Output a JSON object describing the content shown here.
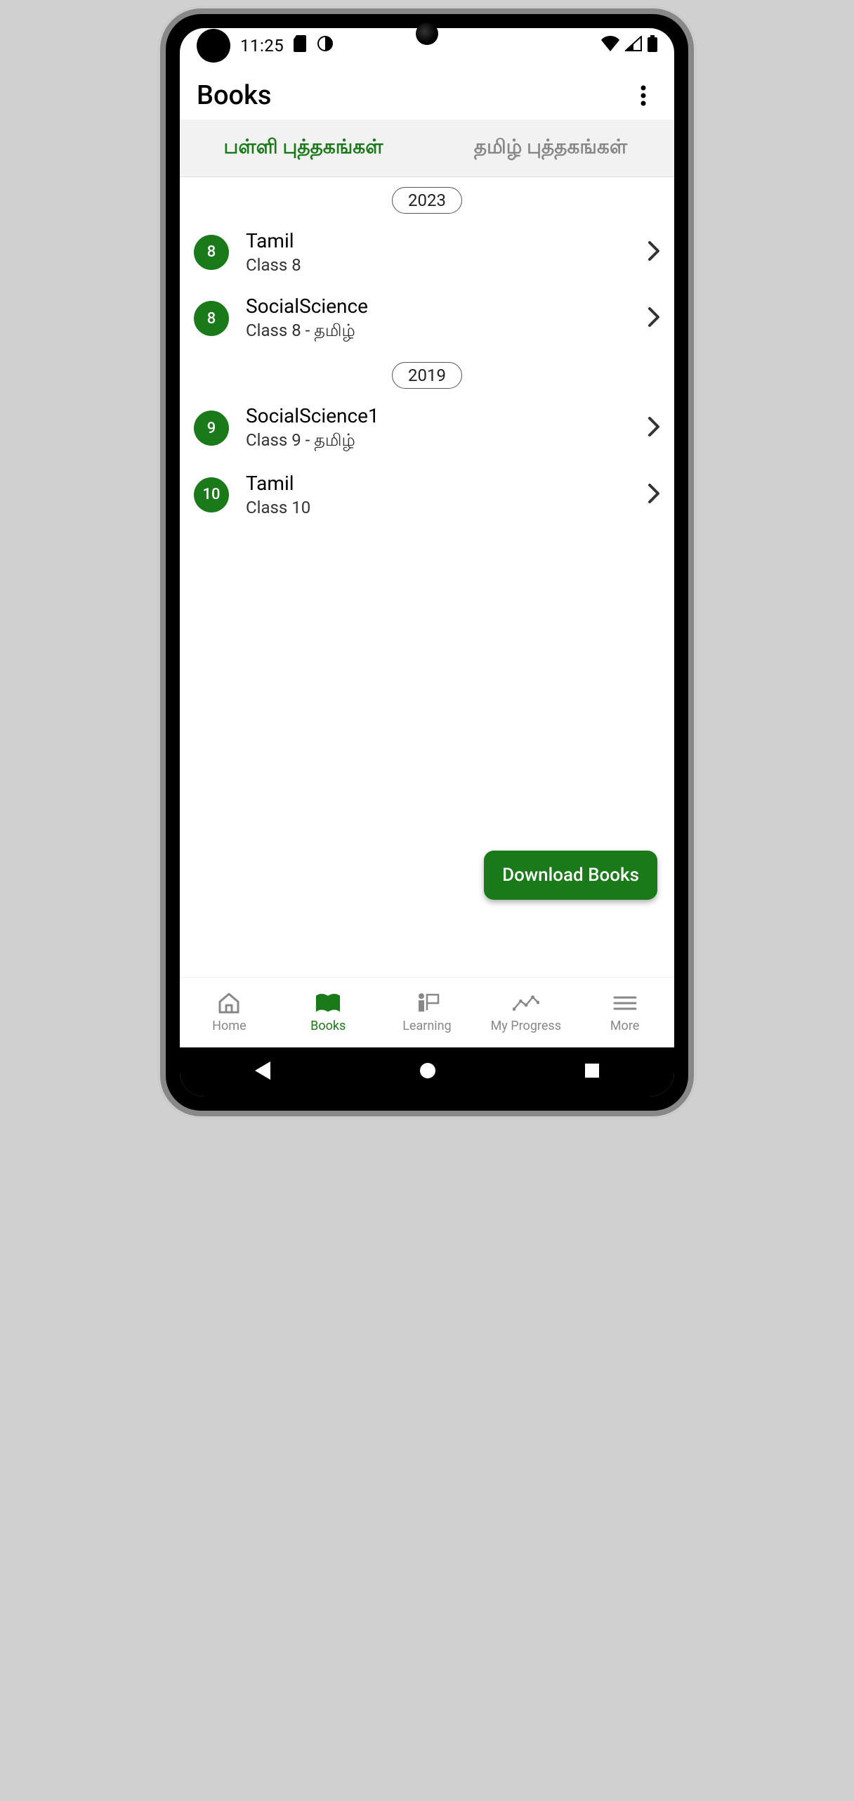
{
  "status": {
    "time": "11:25"
  },
  "header": {
    "title": "Books"
  },
  "tabs": [
    {
      "label": "பள்ளி புத்தகங்கள்",
      "active": true
    },
    {
      "label": "தமிழ் புத்தகங்கள்",
      "active": false
    }
  ],
  "sections": [
    {
      "year": "2023",
      "items": [
        {
          "badge": "8",
          "title": "Tamil",
          "sub": "Class 8"
        },
        {
          "badge": "8",
          "title": "SocialScience",
          "sub": "Class 8 - தமிழ்"
        }
      ]
    },
    {
      "year": "2019",
      "items": [
        {
          "badge": "9",
          "title": "SocialScience1",
          "sub": "Class 9 - தமிழ்"
        },
        {
          "badge": "10",
          "title": "Tamil",
          "sub": "Class 10"
        }
      ]
    }
  ],
  "fab": {
    "label": "Download Books"
  },
  "bottomNav": [
    {
      "label": "Home",
      "icon": "home"
    },
    {
      "label": "Books",
      "icon": "book",
      "active": true
    },
    {
      "label": "Learning",
      "icon": "learning"
    },
    {
      "label": "My Progress",
      "icon": "progress"
    },
    {
      "label": "More",
      "icon": "more"
    }
  ],
  "colors": {
    "accent": "#1a7a1a"
  }
}
